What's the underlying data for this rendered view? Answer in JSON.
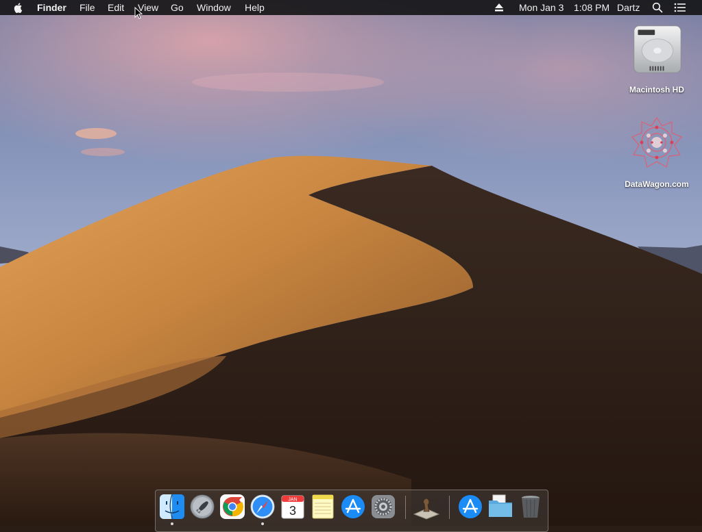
{
  "menubar": {
    "apple_icon": "apple-icon",
    "app_name": "Finder",
    "menus": [
      "File",
      "Edit",
      "View",
      "Go",
      "Window",
      "Help"
    ],
    "date": "Mon Jan 3",
    "time": "1:08 PM",
    "user": "Dartz",
    "status_icons": [
      "eject-icon",
      "spotlight-icon",
      "notification-center-icon"
    ]
  },
  "desktop": {
    "icons": [
      {
        "label": "Macintosh HD",
        "icon": "hard-drive-icon"
      },
      {
        "label": "DataWagon.com",
        "icon": "datawagon-logo-icon"
      }
    ]
  },
  "dock": {
    "apps": [
      {
        "name": "Finder",
        "icon": "finder-icon",
        "running": true
      },
      {
        "name": "Launchpad",
        "icon": "launchpad-icon",
        "running": false
      },
      {
        "name": "Google Chrome",
        "icon": "chrome-icon",
        "running": false
      },
      {
        "name": "Safari",
        "icon": "safari-icon",
        "running": true
      },
      {
        "name": "Calendar",
        "icon": "calendar-icon",
        "running": false,
        "month": "JAN",
        "day": "3"
      },
      {
        "name": "Notes",
        "icon": "notes-icon",
        "running": false
      },
      {
        "name": "App Store",
        "icon": "app-store-icon",
        "running": false
      },
      {
        "name": "System Preferences",
        "icon": "system-preferences-icon",
        "running": false
      },
      {
        "name": "Chess",
        "icon": "chess-icon",
        "running": false
      },
      {
        "name": "Applications",
        "icon": "applications-folder-icon",
        "running": false
      },
      {
        "name": "Downloads",
        "icon": "downloads-folder-icon",
        "running": false
      },
      {
        "name": "Trash",
        "icon": "trash-icon",
        "running": false
      }
    ]
  },
  "colors": {
    "menubar_bg": "#161618",
    "sky_top": "#6f7fa6",
    "sky_pink": "#d9a0a8",
    "dune_light": "#c98a42",
    "dune_dark": "#2f2019"
  }
}
